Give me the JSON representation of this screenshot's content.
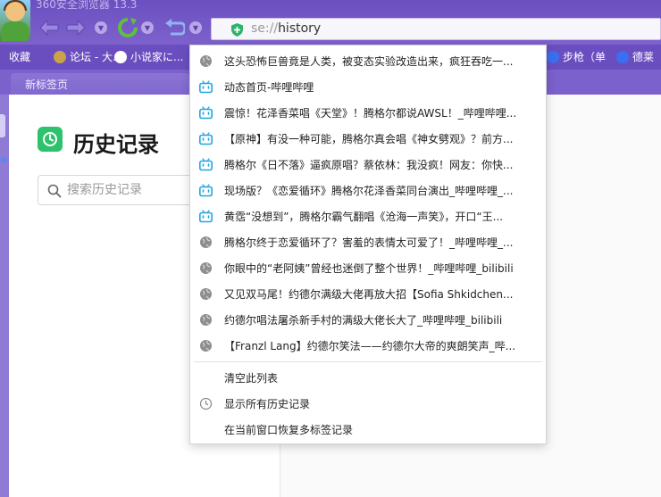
{
  "window": {
    "title": "360安全浏览器 13.3"
  },
  "toolbar": {
    "back_icon": "back-arrow-icon",
    "forward_icon": "forward-arrow-icon",
    "refresh_icon": "refresh-icon",
    "undo_icon": "undo-close-tab-icon",
    "accent_color": "#6b4fc0"
  },
  "address": {
    "scheme": "se://",
    "path": "history"
  },
  "bookmarks": [
    {
      "label": "收藏"
    },
    {
      "label": "论坛 - 大..."
    },
    {
      "label": "小说家に..."
    },
    {
      "label": "步枪（单"
    },
    {
      "label": "德莱"
    }
  ],
  "tabs": [
    {
      "label": "新标签页"
    }
  ],
  "page": {
    "title": "历史记录",
    "search_placeholder": "搜索历史记录"
  },
  "menu": {
    "items": [
      {
        "label": "这头恐怖巨兽竟是人类，被变态实验改造出来，疯狂吞吃一...",
        "icon": "globe-icon"
      },
      {
        "label": "动态首页-哔哩哔哩",
        "icon": "bilibili-icon"
      },
      {
        "label": "震惊！花泽香菜唱《天堂》！腾格尔都说AWSL！_哔哩哔哩...",
        "icon": "bilibili-icon"
      },
      {
        "label": "【原神】有没一种可能，腾格尔真会唱《神女劈观》？前方...",
        "icon": "bilibili-icon"
      },
      {
        "label": "腾格尔《日不落》逼疯原唱？蔡依林：我没疯！网友：你快...",
        "icon": "bilibili-icon"
      },
      {
        "label": "现场版？《恋爱循环》腾格尔花泽香菜同台演出_哔哩哔哩_...",
        "icon": "bilibili-icon"
      },
      {
        "label": "黄霑“没想到”，腾格尔霸气翻唱《沧海一声笑》，开口“王...",
        "icon": "bilibili-icon"
      },
      {
        "label": "腾格尔终于恋爱循环了？害羞的表情太可爱了！_哔哩哔哩_...",
        "icon": "globe-icon"
      },
      {
        "label": "你眼中的“老阿姨”曾经也迷倒了整个世界！_哔哩哔哩_bilibili",
        "icon": "globe-icon"
      },
      {
        "label": "又见双马尾！约德尔满级大佬再放大招【Sofia Shkidchen...",
        "icon": "globe-icon"
      },
      {
        "label": "约德尔唱法屠杀新手村的满级大佬长大了_哔哩哔哩_bilibili",
        "icon": "globe-icon"
      },
      {
        "label": "【Franzl Lang】约德尔笑法——约德尔大帝的爽朗笑声_哔...",
        "icon": "globe-icon"
      }
    ],
    "actions": [
      {
        "label": "清空此列表"
      },
      {
        "label": "显示所有历史记录",
        "icon": "clock-icon"
      },
      {
        "label": "在当前窗口恢复多标签记录"
      }
    ]
  }
}
